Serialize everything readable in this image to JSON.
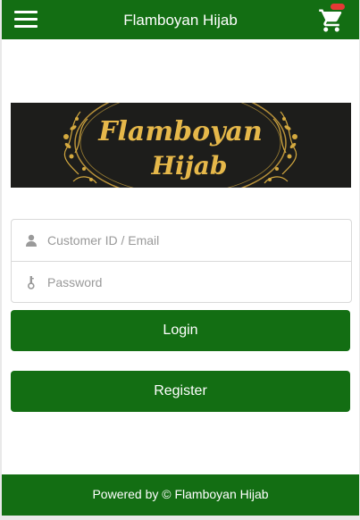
{
  "header": {
    "title": "Flamboyan Hijab",
    "menu_icon": "hamburger-menu-icon",
    "cart_icon": "shopping-cart-icon",
    "badge_color": "#e53935"
  },
  "banner": {
    "logo_line1": "Flamboyan",
    "logo_line2": "Hijab",
    "background": "#1d1d1b",
    "accent": "#d4a93f"
  },
  "login_form": {
    "customer_id_placeholder": "Customer ID / Email",
    "customer_id_value": "",
    "password_placeholder": "Password",
    "password_value": "",
    "user_icon": "user-icon",
    "key_icon": "key-icon"
  },
  "buttons": {
    "login_label": "Login",
    "register_label": "Register"
  },
  "footer": {
    "text": "Powered by © Flamboyan Hijab"
  },
  "colors": {
    "primary": "#136e13"
  }
}
